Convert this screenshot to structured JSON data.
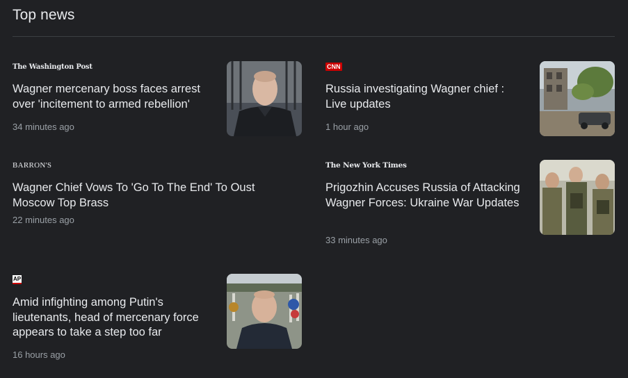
{
  "section": {
    "title": "Top news"
  },
  "articles": [
    {
      "source": "The Washington Post",
      "title": "Wagner mercenary boss faces arrest over 'incitement to armed rebellion'",
      "time": "34 minutes ago",
      "thumbnail": "man-portrait-photo"
    },
    {
      "source": "CNN",
      "title": "Russia investigating Wagner chief : Live updates",
      "time": "1 hour ago",
      "thumbnail": "damaged-building-car-photo"
    },
    {
      "source": "BARRON'S",
      "title": "Wagner Chief Vows To 'Go To The End' To Oust Moscow Top Brass",
      "time": "22 minutes ago"
    },
    {
      "source": "The New York Times",
      "title": "Prigozhin Accuses Russia of Attacking Wagner Forces: Ukraine War Updates",
      "time": "33 minutes ago",
      "thumbnail": "soldiers-group-photo"
    },
    {
      "source": "AP",
      "title": "Amid infighting among Putin's lieutenants, head of mercenary force appears to take a step too far",
      "time": "16 hours ago",
      "thumbnail": "man-cemetery-photo"
    }
  ]
}
